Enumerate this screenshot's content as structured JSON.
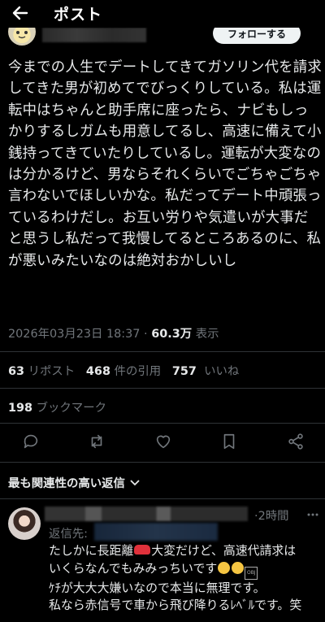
{
  "header": {
    "title": "ポスト"
  },
  "author": {
    "follow_label": "フォローする"
  },
  "post": {
    "text": "今までの人生でデートしてきてガソリン代を請求してきた男が初めてでびっくりしている。私は運転中はちゃんと助手席に座ったら、ナビもしっかりするしガムも用意してるし、高速に備えて小銭持ってきていたりしているし。運転が大変なのは分かるけど、男ならそれくらいでごちゃごちゃ言わないでほしいかな。私だってデート中頑張っているわけだし。お互い労りや気遣いが大事だと思うし私だって我慢してるところあるのに、私が悪いみたいなのは絶対おかしいし",
    "timestamp": "2026年03月23日 18:37",
    "separator": "·",
    "views": "60.3万",
    "views_label": "表示"
  },
  "stats": {
    "reposts_count": "63",
    "reposts_label": "リポスト",
    "quotes_count": "468",
    "quotes_label": "件の引用",
    "likes_count": "757",
    "likes_label": "いいね",
    "bookmarks_count": "198",
    "bookmarks_label": "ブックマーク"
  },
  "sort": {
    "label": "最も関連性の高い返信"
  },
  "reply": {
    "time": "·2時間",
    "replying_to": "返信先:",
    "line1_a": "たしかに長距離",
    "line1_b": "大変だけど、高速代請求は",
    "line2": "いくらなんでもみみっちいです",
    "line3": "ｹﾁが大大大嫌いなので本当に無理です。",
    "line4": "私なら赤信号で車から飛び降りるﾚﾍﾞﾙです。笑"
  },
  "colors": {
    "background": "#000000",
    "text": "#e7e9ea",
    "muted": "#71767b",
    "divider": "#2f3336"
  }
}
